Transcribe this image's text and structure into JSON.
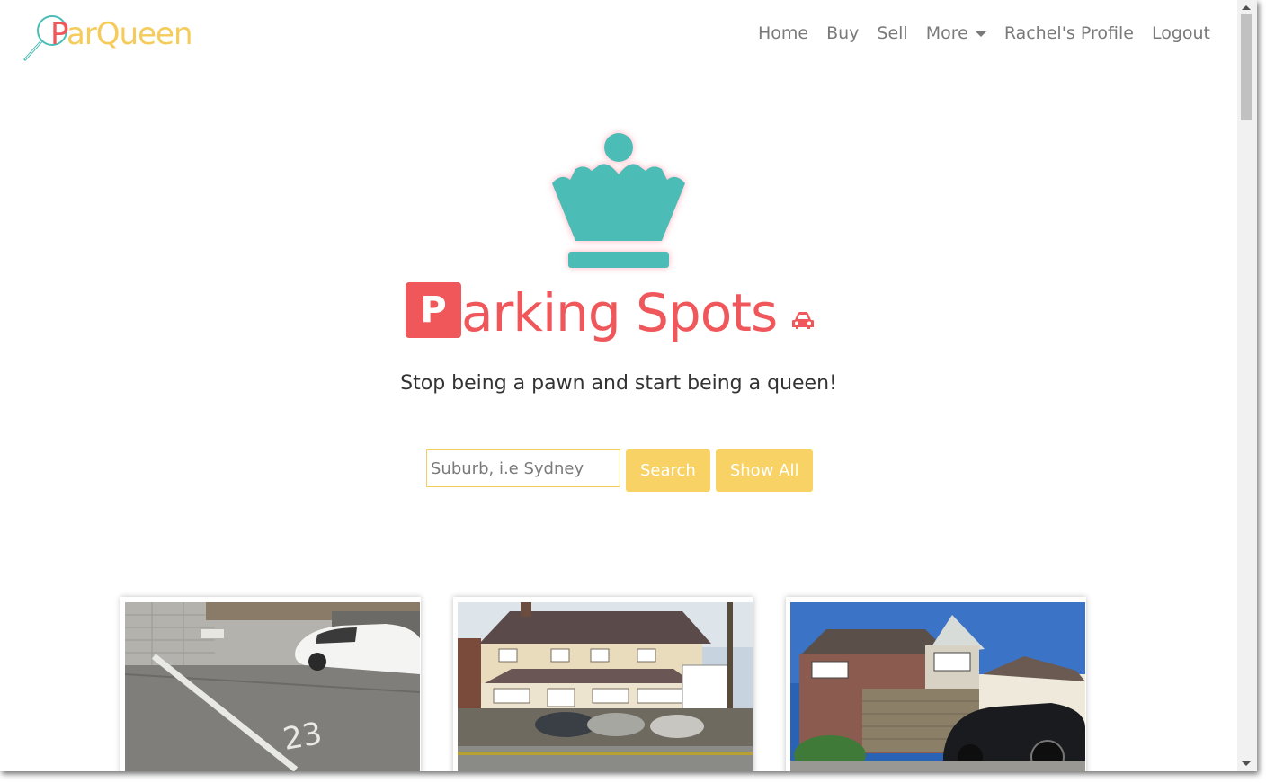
{
  "brand": {
    "first_letter": "P",
    "rest": "arQueen"
  },
  "nav": {
    "home": "Home",
    "buy": "Buy",
    "sell": "Sell",
    "more": "More",
    "profile": "Rachel's Profile",
    "logout": "Logout"
  },
  "hero": {
    "title_initial": "P",
    "title_rest": "arking Spots",
    "tagline": "Stop being a pawn and start being a queen!"
  },
  "search": {
    "placeholder": "Suburb, i.e Sydney",
    "value": "",
    "search_label": "Search",
    "show_all_label": "Show All"
  },
  "colors": {
    "primary": "#f0575b",
    "accent": "#f5cb5c",
    "crown": "#4bbdb6"
  },
  "cards": [
    {
      "image": "parking-garage-spot-23-photo"
    },
    {
      "image": "house-with-driveway-cars-photo"
    },
    {
      "image": "modern-house-garage-photo"
    }
  ]
}
